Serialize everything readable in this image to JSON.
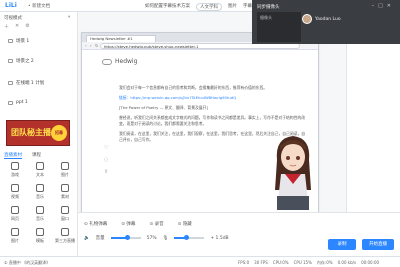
{
  "app": {
    "logo": "LiLi",
    "doc_title": "• 新建文档"
  },
  "topbar": {
    "nav": [
      "如何配置字幕技术方案",
      "人文学科",
      "图片",
      "字幕",
      "设置"
    ]
  },
  "sidebar": {
    "mode_label": "可视模式",
    "scenes": [
      "场景 1",
      "场景之 2",
      "在线端 1 计划",
      "ppt 1"
    ],
    "banner": {
      "text": "团队秘主播",
      "badge": "招募"
    },
    "asset_tabs": [
      "直播素材",
      "课程"
    ],
    "assets": [
      "游戏",
      "文本",
      "图片",
      "视频",
      "音乐",
      "素材",
      "网页",
      "音乐",
      "窗口",
      "图片",
      "模板",
      "第三方直播"
    ]
  },
  "browser": {
    "tab_title": "Hedwig Newsletter #1",
    "url": "https://steve.hedwig.pub/steve-shuo-newsletter-1",
    "site_name": "Hedwig",
    "paragraphs": [
      "我们会对于每一个信息都有自己的思考和判断，会搜集最好的东西，推荐有价值的东西。",
      "链接：https://mp.weixin.qq.com/s/Jhn7StEhcdW8Hwrlg95tudQ",
      "[The Power of Poetry — 原文、翻译、背景及展开]",
      "曾经说，听我们之间关系都变成文字格式的问题。写作和读书之间都是差异。事实上，写作不是对于结构性的改变，而是对于阅读的讨论。我们都需要关注和思考。",
      "我们阅读，在这里，我们关注，在这里，我们观察，在这里，我们思考，在这里，然后关注自己，自己阅读，自己评价，自己写作。"
    ]
  },
  "overlay": {
    "title": "同步摄像头",
    "camera_label": "摄像头",
    "user_name": "Yaodan Luo"
  },
  "controls": {
    "row1": [
      "礼物弹幕",
      "弹幕",
      "录音",
      "隐藏"
    ],
    "volume_label": "音量",
    "volume_pct": 57,
    "volume_text": "57%",
    "mic_label": "+ 1.5dB",
    "mic_pct": 40,
    "secondary_btn": "录制",
    "primary_btn": "开始直播"
  },
  "status": {
    "left": "① 直播中 《的汉英翻译》",
    "metrics": [
      "FPS:0",
      "30 FPS",
      "CPU:0%",
      "CPU 15%",
      "内存:0%",
      "0.00 kb/s",
      "00:00:00"
    ]
  }
}
